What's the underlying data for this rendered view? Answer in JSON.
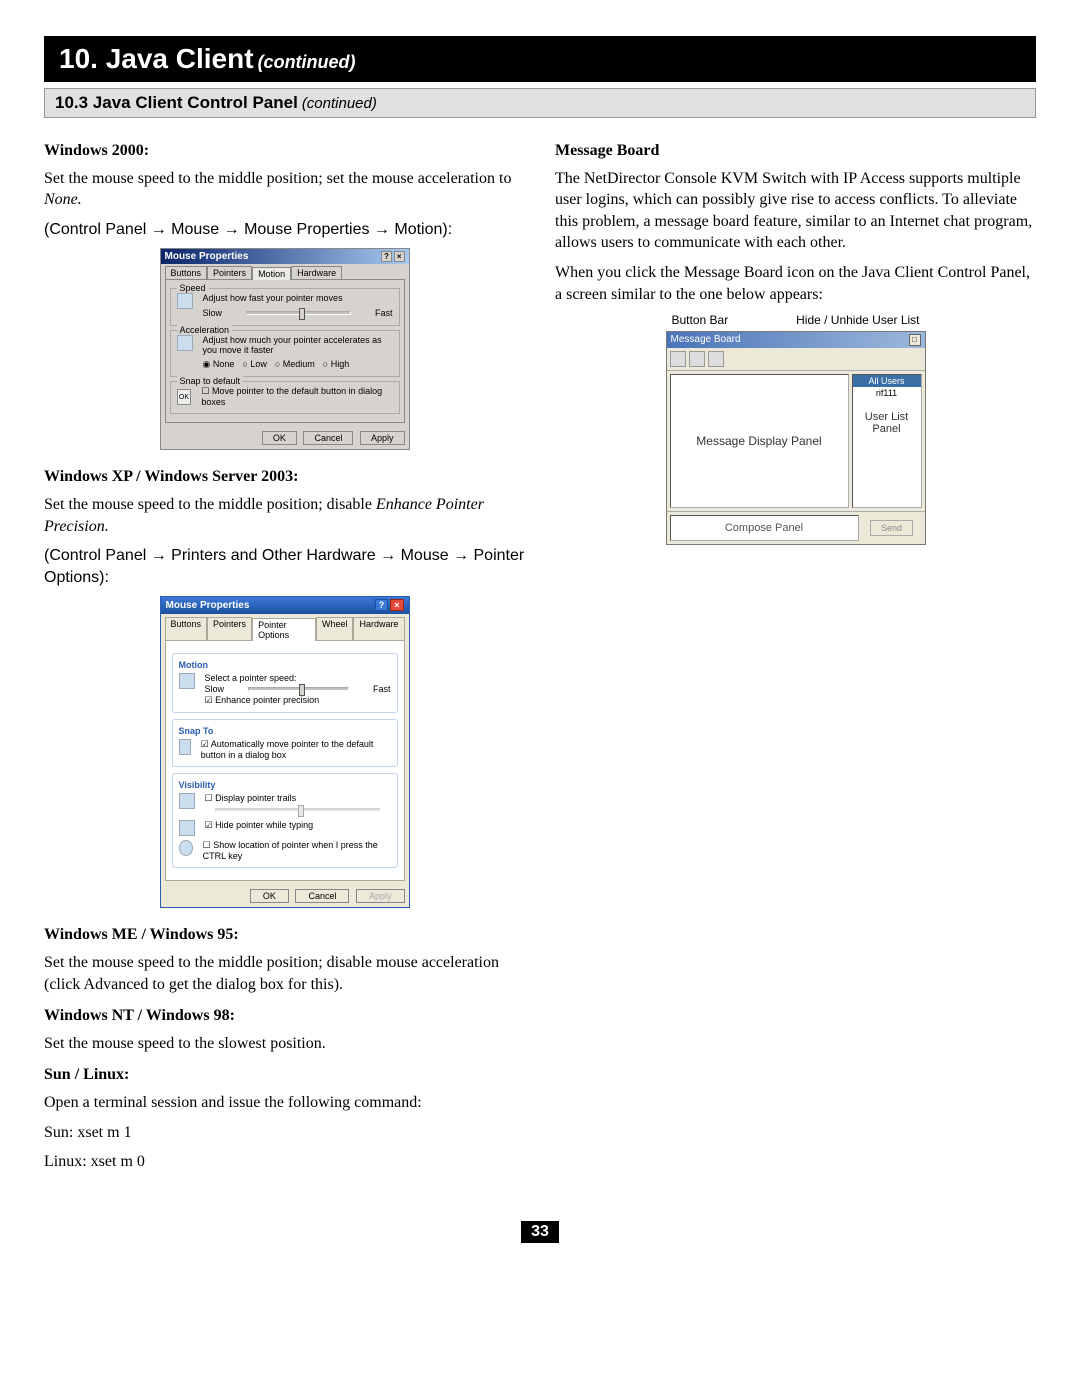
{
  "chapter": {
    "title": "10. Java Client",
    "continued": "(continued)"
  },
  "section": {
    "title": "10.3 Java Client Control Panel",
    "continued": "(continued)"
  },
  "left": {
    "w2000_head": "Windows 2000:",
    "w2000_p1a": "Set the mouse speed to the middle position; set the mouse acceleration to ",
    "w2000_p1b": "None.",
    "w2000_path": "(Control Panel → Mouse → Mouse Properties → Motion):",
    "wxp_head": "Windows XP / Windows Server 2003:",
    "wxp_p1a": "Set the mouse speed to the middle position; disable ",
    "wxp_p1b": "Enhance Pointer Precision.",
    "wxp_path": "(Control Panel → Printers and Other Hardware → Mouse → Pointer Options):",
    "wme_head": "Windows ME / Windows 95:",
    "wme_p": "Set the mouse speed to the middle position; disable mouse acceleration (click Advanced to get the dialog box for this).",
    "wnt_head": "Windows NT / Windows 98:",
    "wnt_p": "Set the mouse speed to the slowest position.",
    "sun_head": "Sun / Linux:",
    "sun_p": "Open a terminal session and issue the following command:",
    "sun_cmd": "Sun: xset m 1",
    "linux_cmd": "Linux: xset m 0"
  },
  "dlg2k": {
    "title": "Mouse Properties",
    "tabs": [
      "Buttons",
      "Pointers",
      "Motion",
      "Hardware"
    ],
    "speed_title": "Speed",
    "speed_txt": "Adjust how fast your pointer moves",
    "slow": "Slow",
    "fast": "Fast",
    "accel_title": "Acceleration",
    "accel_txt": "Adjust how much your pointer accelerates as you move it faster",
    "accel_opts": [
      "None",
      "Low",
      "Medium",
      "High"
    ],
    "snap_title": "Snap to default",
    "snap_txt": "Move pointer to the default button in dialog boxes",
    "ok": "OK",
    "cancel": "Cancel",
    "apply": "Apply"
  },
  "dlgxp": {
    "title": "Mouse Properties",
    "tabs": [
      "Buttons",
      "Pointers",
      "Pointer Options",
      "Wheel",
      "Hardware"
    ],
    "motion_title": "Motion",
    "motion_txt": "Select a pointer speed:",
    "slow": "Slow",
    "fast": "Fast",
    "enhance": "Enhance pointer precision",
    "snapto_title": "Snap To",
    "snapto_txt": "Automatically move pointer to the default button in a dialog box",
    "vis_title": "Visibility",
    "vis1": "Display pointer trails",
    "vis2": "Hide pointer while typing",
    "vis3": "Show location of pointer when I press the CTRL key",
    "ok": "OK",
    "cancel": "Cancel",
    "apply": "Apply"
  },
  "right": {
    "mb_head": "Message Board",
    "mb_p1": "The NetDirector Console KVM Switch with IP Access supports multiple user logins, which can possibly give rise to access conflicts. To alleviate this problem, a message board feature, similar to an Internet chat program, allows users to communicate with each other.",
    "mb_p2": "When you click the Message Board icon on the Java Client Control Panel, a screen similar to the one below appears:"
  },
  "msgboard": {
    "lbl_buttonbar": "Button Bar",
    "lbl_hide": "Hide / Unhide User List",
    "wintitle": "Message Board",
    "allusers": "All Users",
    "user": "rif111",
    "display_lbl": "Message Display Panel",
    "userlist_lbl": "User List Panel",
    "compose_lbl": "Compose Panel",
    "send": "Send"
  },
  "page": "33"
}
